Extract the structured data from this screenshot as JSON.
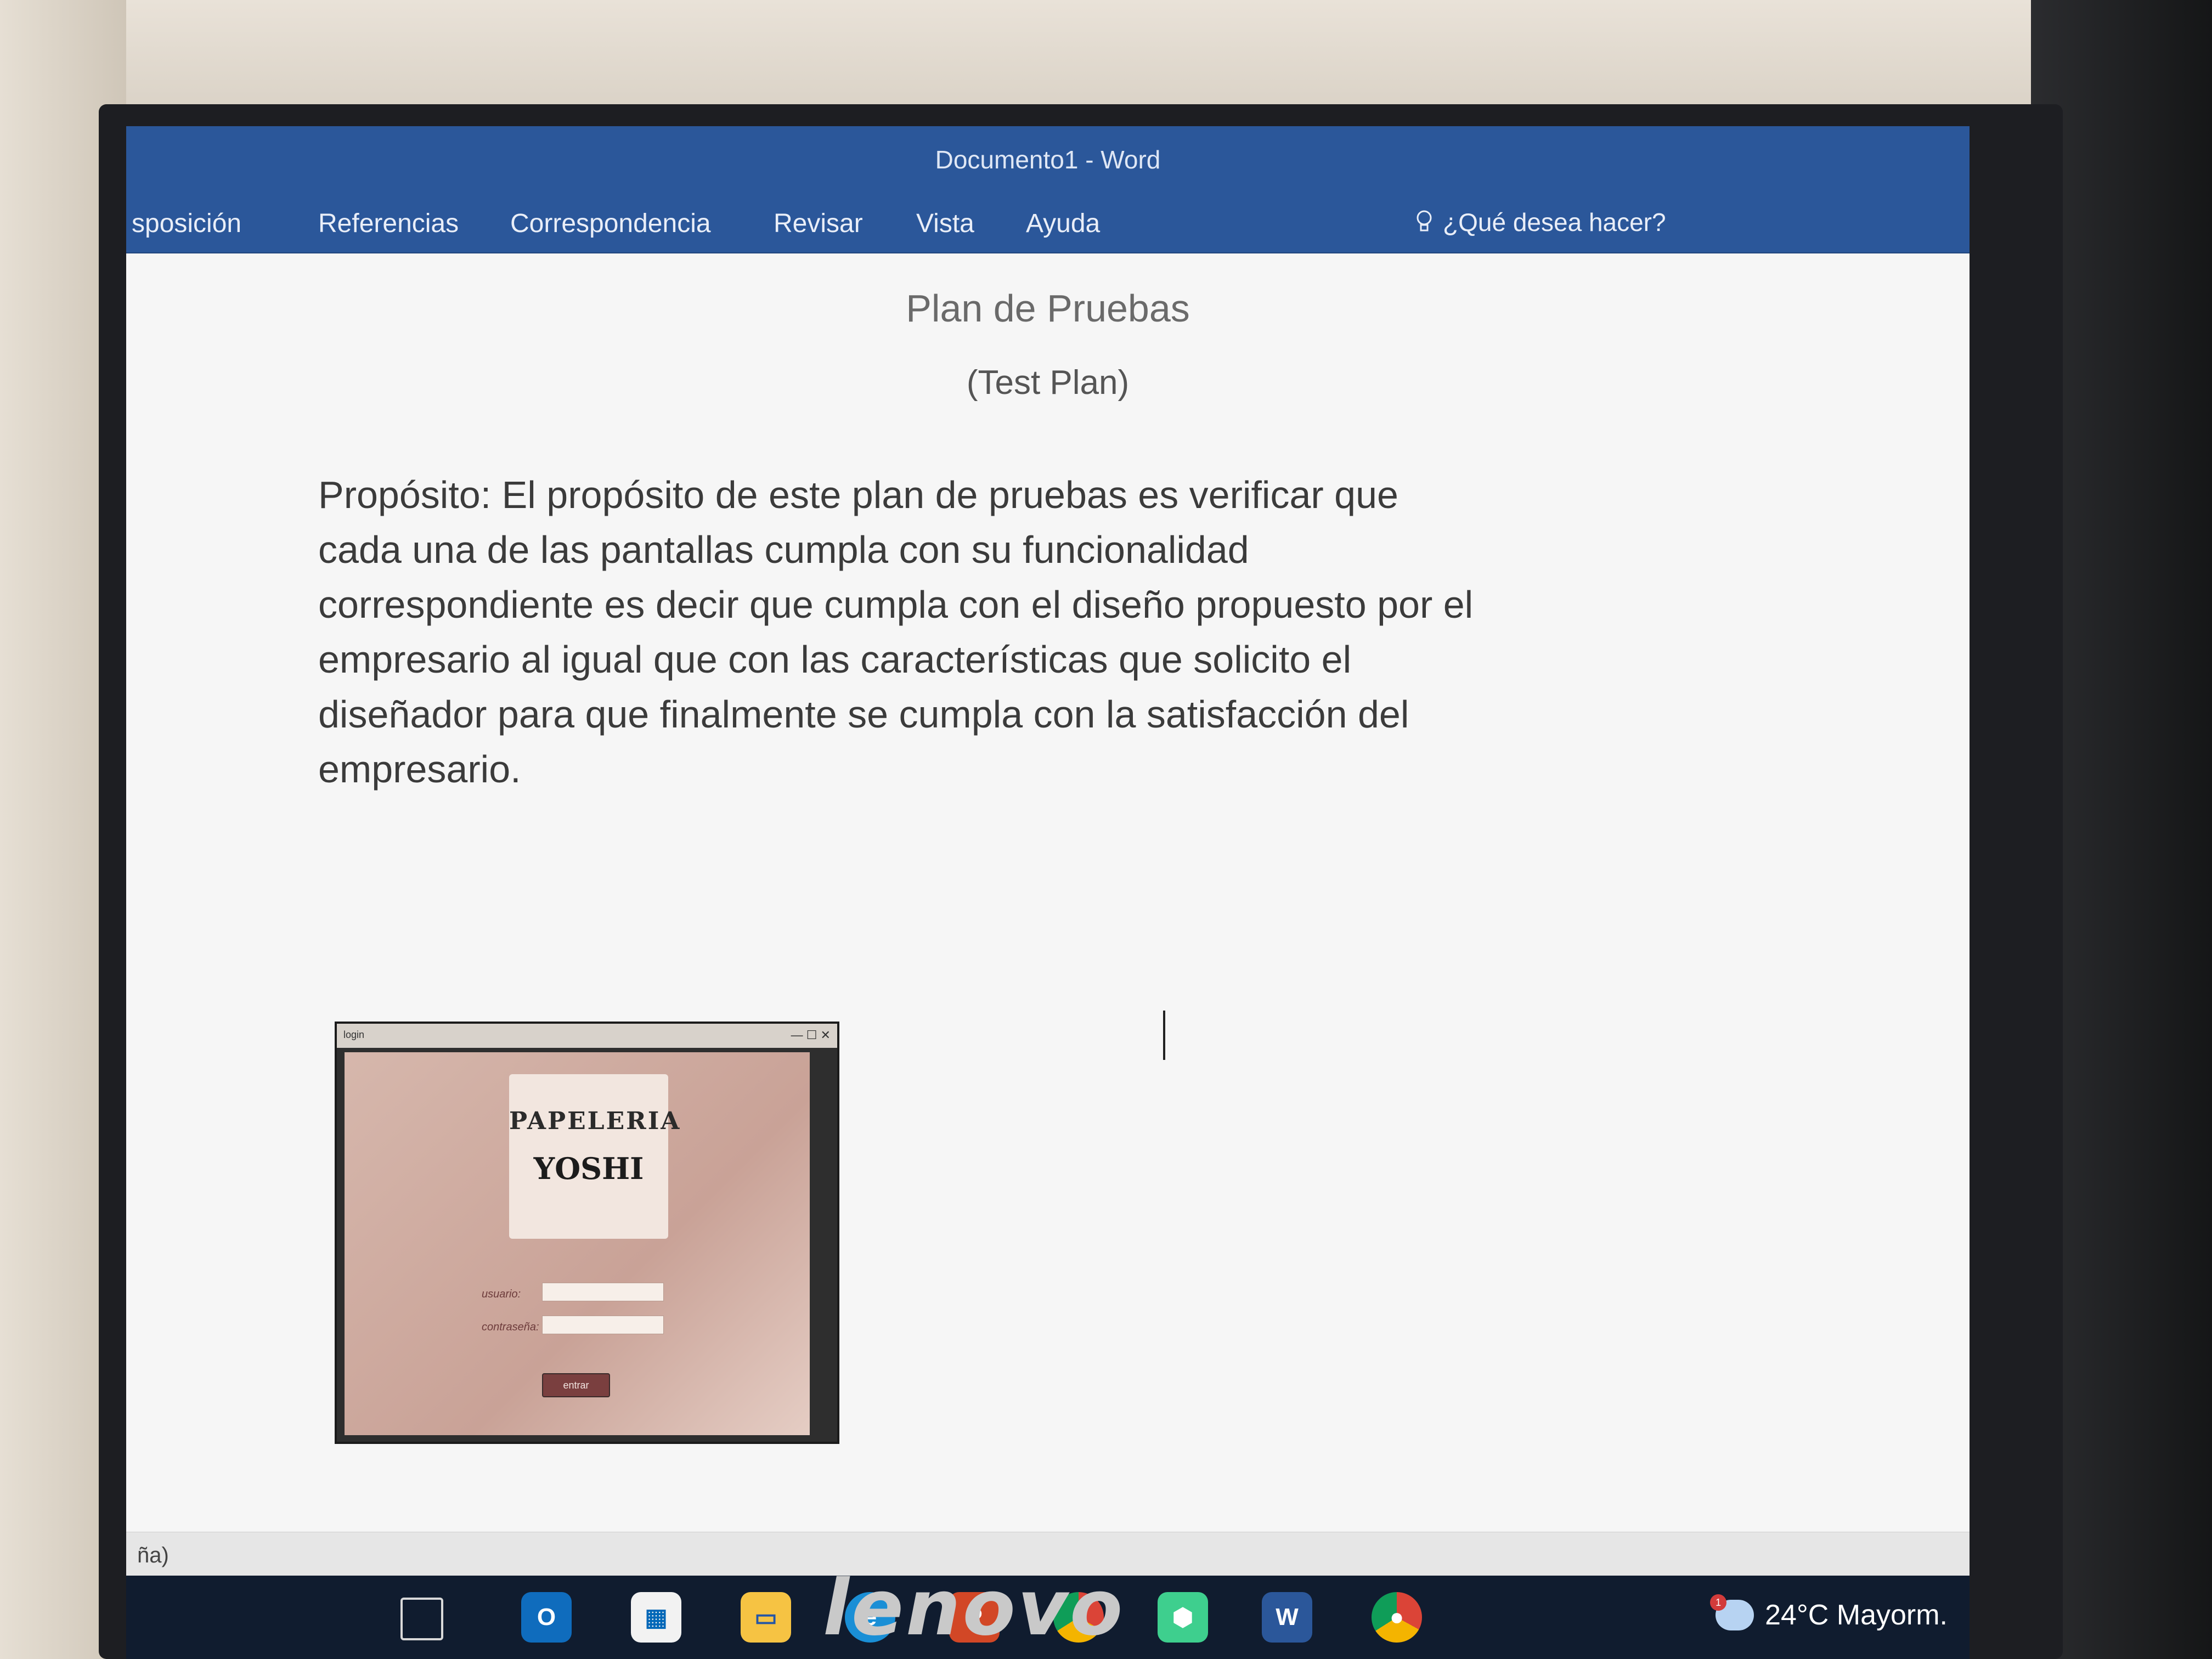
{
  "window": {
    "title": "Documento1 - Word"
  },
  "ribbon": {
    "tabs": [
      "sposición",
      "Referencias",
      "Correspondencia",
      "Revisar",
      "Vista",
      "Ayuda"
    ],
    "tell_me": "¿Qué desea hacer?"
  },
  "document": {
    "title": "Plan de Pruebas",
    "subtitle": "(Test Plan)",
    "body": "Propósito: El propósito de este plan de pruebas es verificar que cada una de las pantallas cumpla con su funcionalidad correspondiente es decir que cumpla con el diseño propuesto por el empresario al igual que con las características que solicito el diseñador para que finalmente se cumpla con la satisfacción del empresario.",
    "embedded_image": {
      "window_title": "login",
      "window_controls": "— ☐ ✕",
      "logo_top": "PAPELERIA",
      "logo_bottom": "YOSHI",
      "user_label": "usuario:",
      "password_label": "contraseña:",
      "button": "entrar"
    }
  },
  "status_bar": {
    "text": "ña)"
  },
  "taskbar": {
    "apps": [
      "task-view",
      "outlook",
      "store",
      "file-explorer",
      "edge",
      "powerpoint",
      "chrome",
      "app-cube",
      "word",
      "chrome-profile"
    ],
    "weather": {
      "temperature": "24°C",
      "condition": "Mayorm.",
      "badge": "1"
    }
  },
  "monitor": {
    "brand": "lenovo"
  }
}
